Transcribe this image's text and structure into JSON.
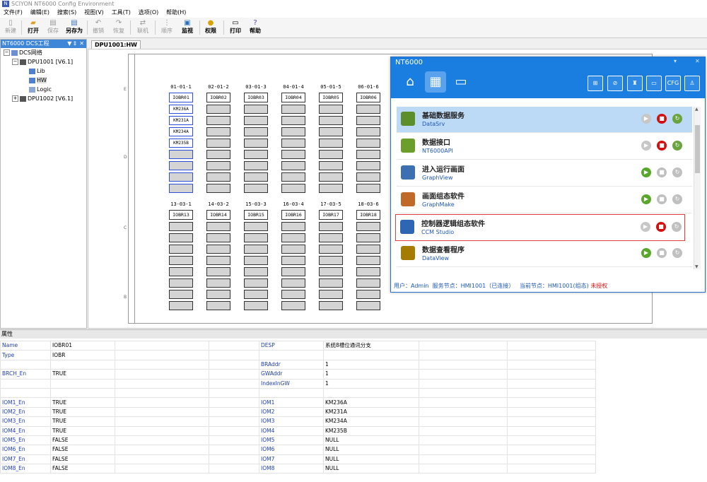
{
  "window": {
    "title": "SCIYON NT6000 Config Environment",
    "app_icon": "N"
  },
  "menu": [
    "文件(F)",
    "编辑(E)",
    "搜索(S)",
    "视图(V)",
    "工具(T)",
    "选项(O)",
    "帮助(H)"
  ],
  "toolbar": [
    {
      "label": "新建",
      "icon": "new-file-icon",
      "enabled": false
    },
    {
      "label": "打开",
      "icon": "open-icon",
      "enabled": true
    },
    {
      "label": "保存",
      "icon": "save-icon",
      "enabled": false
    },
    {
      "label": "另存为",
      "icon": "save-as-icon",
      "enabled": true
    },
    {
      "label": "撤销",
      "icon": "undo-icon",
      "enabled": false
    },
    {
      "label": "恢复",
      "icon": "redo-icon",
      "enabled": false
    },
    {
      "label": "联机",
      "icon": "online-icon",
      "enabled": false
    },
    {
      "label": "顺序",
      "icon": "sequence-icon",
      "enabled": false
    },
    {
      "label": "监视",
      "icon": "monitor-icon",
      "enabled": true
    },
    {
      "label": "权限",
      "icon": "permission-icon",
      "enabled": true
    },
    {
      "label": "打印",
      "icon": "print-icon",
      "enabled": true
    },
    {
      "label": "帮助",
      "icon": "help-icon",
      "enabled": true
    }
  ],
  "tree": {
    "header": "NT6000 DCS工程",
    "pin": "▼ ‡",
    "close": "✕",
    "nodes": [
      {
        "label": "DCS网络"
      },
      {
        "label": "DPU1001 [V6.1]"
      },
      {
        "label": "Lib"
      },
      {
        "label": "HW"
      },
      {
        "label": "Logic"
      },
      {
        "label": "DPU1002 [V6.1]"
      }
    ]
  },
  "doc_tab": "DPU1001:HW",
  "sheet_rows": [
    "E",
    "D",
    "C",
    "B"
  ],
  "racks_top": [
    {
      "label": "01-01-1",
      "head": "IOBR01",
      "slots": [
        "KM236A",
        "KM231A",
        "KM234A",
        "KM235B",
        "",
        "",
        "",
        ""
      ]
    },
    {
      "label": "02-01-2",
      "head": "IOBR02",
      "slots": [
        "",
        "",
        "",
        "",
        "",
        "",
        "",
        ""
      ]
    },
    {
      "label": "03-01-3",
      "head": "IOBR03",
      "slots": [
        "",
        "",
        "",
        "",
        "",
        "",
        "",
        ""
      ]
    },
    {
      "label": "04-01-4",
      "head": "IOBR04",
      "slots": [
        "",
        "",
        "",
        "",
        "",
        "",
        "",
        ""
      ]
    },
    {
      "label": "05-01-5",
      "head": "IOBR05",
      "slots": [
        "",
        "",
        "",
        "",
        "",
        "",
        "",
        ""
      ]
    },
    {
      "label": "06-01-6",
      "head": "IOBR06",
      "slots": [
        "",
        "",
        "",
        "",
        "",
        "",
        "",
        ""
      ]
    }
  ],
  "racks_bottom": [
    {
      "label": "13-03-1",
      "head": "IOBR13"
    },
    {
      "label": "14-03-2",
      "head": "IOBR14"
    },
    {
      "label": "15-03-3",
      "head": "IOBR15"
    },
    {
      "label": "16-03-4",
      "head": "IOBR16"
    },
    {
      "label": "17-03-5",
      "head": "IOBR17"
    },
    {
      "label": "18-03-6",
      "head": "IOBR18"
    }
  ],
  "props": {
    "header": "属性",
    "rows": [
      [
        "Name",
        "IOBR01",
        "",
        "DESP",
        "系统8槽位通讯分支"
      ],
      [
        "Type",
        "IOBR",
        "",
        "",
        ""
      ],
      [
        "",
        "",
        "",
        "BRAddr",
        "1"
      ],
      [
        "BRCH_En",
        "TRUE",
        "",
        "GWAddr",
        "1"
      ],
      [
        "",
        "",
        "",
        "IndexInGW",
        "1"
      ],
      [
        "",
        "",
        "",
        "",
        ""
      ],
      [
        "IOM1_En",
        "TRUE",
        "",
        "IOM1",
        "KM236A"
      ],
      [
        "IOM2_En",
        "TRUE",
        "",
        "IOM2",
        "KM231A"
      ],
      [
        "IOM3_En",
        "TRUE",
        "",
        "IOM3",
        "KM234A"
      ],
      [
        "IOM4_En",
        "TRUE",
        "",
        "IOM4",
        "KM235B"
      ],
      [
        "IOM5_En",
        "FALSE",
        "",
        "IOM5",
        "NULL"
      ],
      [
        "IOM6_En",
        "FALSE",
        "",
        "IOM6",
        "NULL"
      ],
      [
        "IOM7_En",
        "FALSE",
        "",
        "IOM7",
        "NULL"
      ],
      [
        "IOM8_En",
        "FALSE",
        "",
        "IOM8",
        "NULL"
      ]
    ]
  },
  "popup": {
    "title": "NT6000",
    "window_controls": [
      "▾",
      "✕"
    ],
    "nav_icons": [
      "home-icon",
      "apps-icon",
      "monitor-icon"
    ],
    "tool_icons": [
      {
        "icon": "network-icon",
        "label": ""
      },
      {
        "icon": "mute-icon",
        "label": ""
      },
      {
        "icon": "alarm-icon",
        "label": ""
      },
      {
        "icon": "display-icon",
        "label": ""
      },
      {
        "icon": "cfg-icon",
        "label": "CFG"
      },
      {
        "icon": "user-icon",
        "label": ""
      }
    ],
    "services": [
      {
        "name": "基础数据服务",
        "sub": "DataSrv",
        "state": "running",
        "highlight": true
      },
      {
        "name": "数据接口",
        "sub": "NT6000API",
        "state": "running"
      },
      {
        "name": "进入运行画面",
        "sub": "GraphView",
        "state": "stopped"
      },
      {
        "name": "画面组态软件",
        "sub": "GraphMake",
        "state": "stopped"
      },
      {
        "name": "控制器逻辑组态软件",
        "sub": "CCM Studio",
        "state": "running-noreset",
        "boxed": true
      },
      {
        "name": "数据查看程序",
        "sub": "DataView",
        "state": "stopped"
      }
    ],
    "status": {
      "user": "用户：Admin",
      "server": "服务节点：HMI1001（已连接）",
      "current": "当前节点：HMI1001(组态)",
      "auth": "未授权"
    }
  }
}
